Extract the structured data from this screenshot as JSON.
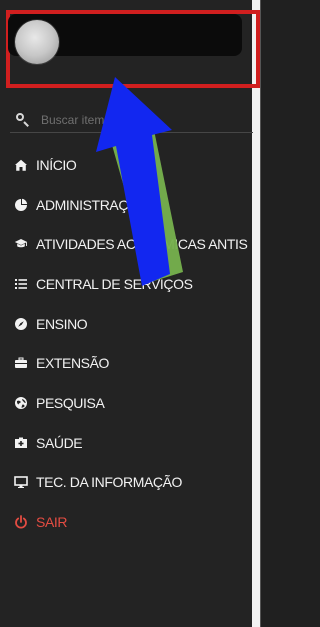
{
  "search": {
    "placeholder": "Buscar item no menu"
  },
  "menu": {
    "items": [
      {
        "label": "INÍCIO",
        "icon": "home-icon"
      },
      {
        "label": "ADMINISTRAÇÃO",
        "icon": "pie-chart-icon"
      },
      {
        "label": "ATIVIDADES ACADÊMICAS ANTIS",
        "icon": "graduation-cap-icon"
      },
      {
        "label": "CENTRAL DE SERVIÇOS",
        "icon": "list-icon"
      },
      {
        "label": "ENSINO",
        "icon": "compass-icon"
      },
      {
        "label": "EXTENSÃO",
        "icon": "briefcase-icon"
      },
      {
        "label": "PESQUISA",
        "icon": "globe-icon"
      },
      {
        "label": "SAÚDE",
        "icon": "medical-kit-icon"
      },
      {
        "label": "TEC. DA INFORMAÇÃO",
        "icon": "monitor-icon"
      },
      {
        "label": "SAIR",
        "icon": "power-icon"
      }
    ]
  },
  "colors": {
    "sidebar_bg": "#232323",
    "highlight_red": "#d11f1f",
    "exit_red": "#e34c42",
    "arrow_blue": "#1227f0",
    "arrow_green": "#76b04d"
  }
}
